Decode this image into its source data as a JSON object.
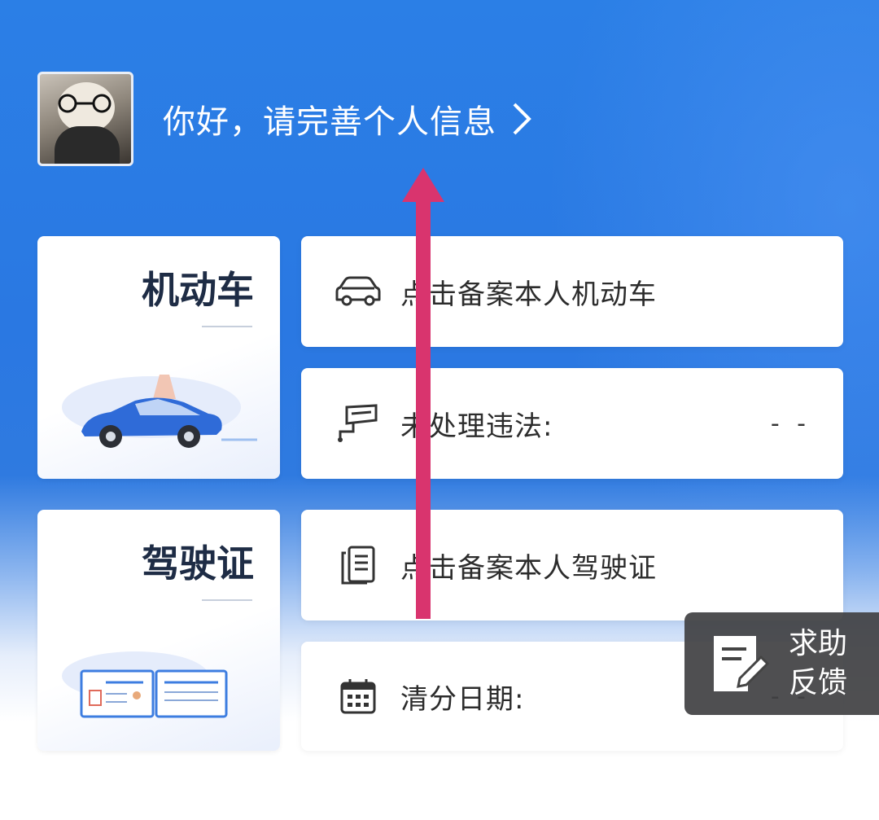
{
  "header": {
    "greeting": "你好，请完善个人信息"
  },
  "vehicle_card": {
    "title": "机动车"
  },
  "license_card": {
    "title": "驾驶证"
  },
  "rows": [
    {
      "label": "点击备案本人机动车",
      "icon": "car-icon"
    },
    {
      "label": "未处理违法:",
      "value": "- -",
      "icon": "traffic-camera-icon"
    },
    {
      "label": "点击备案本人驾驶证",
      "icon": "license-doc-icon"
    },
    {
      "label": "清分日期:",
      "value": "- -",
      "icon": "calendar-icon"
    }
  ],
  "help_button": {
    "line1": "求助",
    "line2": "反馈",
    "icon": "edit-note-icon"
  },
  "colors": {
    "primary_blue": "#2b7fe6",
    "annotation_arrow": "#d9346e"
  }
}
